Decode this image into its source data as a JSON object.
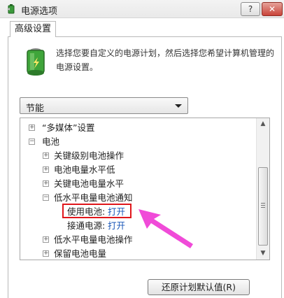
{
  "window": {
    "title": "电源选项",
    "help_label": "?",
    "close_label": "✕"
  },
  "tab": {
    "label": "高级设置"
  },
  "description": "选择您要自定义的电源计划，然后选择您希望计算机管理的电源设置。",
  "plan": {
    "selected": "节能"
  },
  "tree": {
    "multimedia_label": "“多媒体”设置",
    "battery_label": "电池",
    "critical_action_label": "关键级别电池操作",
    "low_level_label": "电池电量水平低",
    "critical_level_label": "关键电池电量水平",
    "low_notify_label": "低水平电量电池通知",
    "on_battery": {
      "label": "使用电池:",
      "value": "打开"
    },
    "plugged_in": {
      "label": "接通电源:",
      "value": "打开"
    },
    "low_action_label": "低水平电量电池操作",
    "reserve_label": "保留电池电量"
  },
  "expanders": {
    "plus": "+",
    "minus": "−"
  },
  "scroll": {
    "up": "▲",
    "down": "▼"
  },
  "buttons": {
    "restore_label": "还原计划默认值(R)"
  },
  "colors": {
    "highlight": "#e0161b",
    "arrow": "#f04bd8",
    "value_link": "#1a57b8"
  }
}
